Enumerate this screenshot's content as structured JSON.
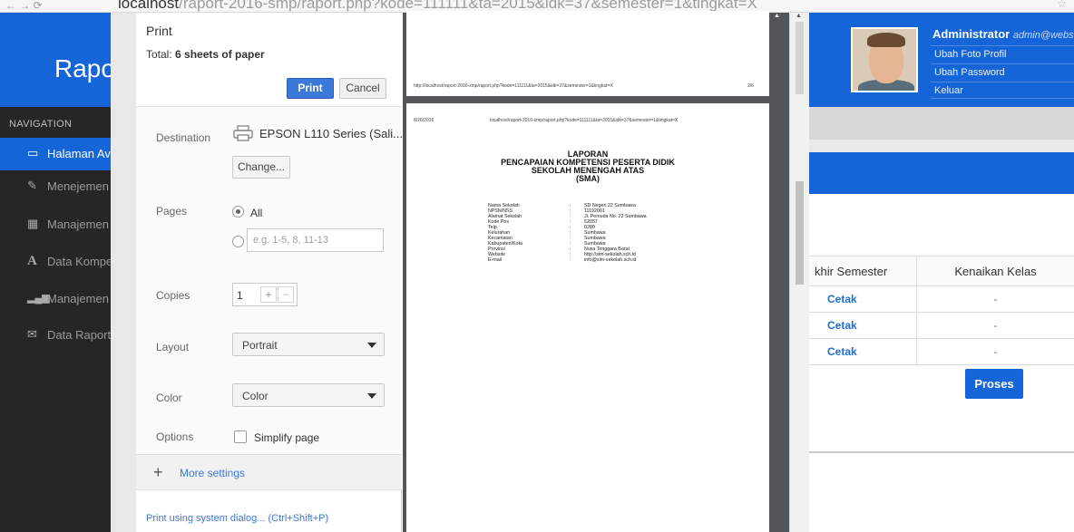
{
  "browser": {
    "url_host": "localhost",
    "url_rest": "/raport-2016-smp/raport.php?kode=111111&ta=2015&idk=37&semester=1&tingkat=X"
  },
  "sidebar": {
    "brand": "Rapo",
    "nav_title": "NAVIGATION",
    "items": [
      {
        "label": "Halaman Av",
        "icon": "monitor-icon",
        "active": true
      },
      {
        "label": "Menejemen",
        "icon": "pencil-icon"
      },
      {
        "label": "Manajemen",
        "icon": "calendar-icon"
      },
      {
        "label": "Data Kompe",
        "icon": "letter-a-icon"
      },
      {
        "label": "Manajemen",
        "icon": "bar-chart-icon"
      },
      {
        "label": "Data Raport",
        "icon": "envelope-icon"
      }
    ]
  },
  "print_dialog": {
    "title": "Print",
    "total_prefix": "Total: ",
    "total_value": "6 sheets of paper",
    "print_label": "Print",
    "cancel_label": "Cancel",
    "destination_label": "Destination",
    "destination_value": "EPSON L110 Series (Sali...",
    "change_label": "Change...",
    "pages_label": "Pages",
    "pages_all": "All",
    "pages_placeholder": "e.g. 1-5, 8, 11-13",
    "copies_label": "Copies",
    "copies_value": "1",
    "plus": "+",
    "minus": "−",
    "layout_label": "Layout",
    "layout_value": "Portrait",
    "color_label": "Color",
    "color_value": "Color",
    "options_label": "Options",
    "simplify_label": "Simplify page",
    "more_settings": "More settings",
    "system_dialog": "Print using system dialog... (Ctrl+Shift+P)"
  },
  "preview": {
    "page_a_url": "http://localhost/raport-2016-smp/raport.php?kode=111111&ta=2015&idk=37&semester=1&tingkat=X",
    "page_a_num": "2/6",
    "page_b_date": "8/26/2016",
    "page_b_url": "localhost/raport-2016-smp/raport.php?kode=111111&ta=2015&idk=37&semester=1&tingkat=X",
    "title_lines": [
      "LAPORAN",
      "PENCAPAIAN KOMPETENSI PESERTA DIDIK",
      "SEKOLAH MENENGAH ATAS",
      "(SMA)"
    ],
    "info_rows": [
      {
        "k": "Nama Sekolah",
        "v": "SD Negeri 22 Sumbawa"
      },
      {
        "k": "NPSN/NSS",
        "v": "11192001"
      },
      {
        "k": "Alamat Sekolah",
        "v": "Jl. Pemuda No. 22 Sumbawa"
      },
      {
        "k": "Kode Pos",
        "v": "52357"
      },
      {
        "k": "Telp.",
        "v": "0280"
      },
      {
        "k": "Kelurahan",
        "v": "Sumbawa"
      },
      {
        "k": "Kecamatan",
        "v": "Sumbawa"
      },
      {
        "k": "Kabupaten/Kota",
        "v": "Sumbawa"
      },
      {
        "k": "Provinsi",
        "v": "Nusa Tenggara Barat"
      },
      {
        "k": "Website",
        "v": "http://sim-sekolah.sch.id"
      },
      {
        "k": "E-mail",
        "v": "info@sim-sekolah.sch.id"
      }
    ]
  },
  "right_page": {
    "admin_name": "Administrator",
    "admin_email": "admin@webs",
    "menu": [
      "Ubah Foto Profil",
      "Ubah Password",
      "Keluar"
    ],
    "col_semester": "khir Semester",
    "col_kenaikan": "Kenaikan Kelas",
    "rows": [
      {
        "cetak": "Cetak",
        "kenaikan": "-"
      },
      {
        "cetak": "Cetak",
        "kenaikan": "-"
      },
      {
        "cetak": "Cetak",
        "kenaikan": "-"
      }
    ],
    "proses_label": "Proses"
  }
}
